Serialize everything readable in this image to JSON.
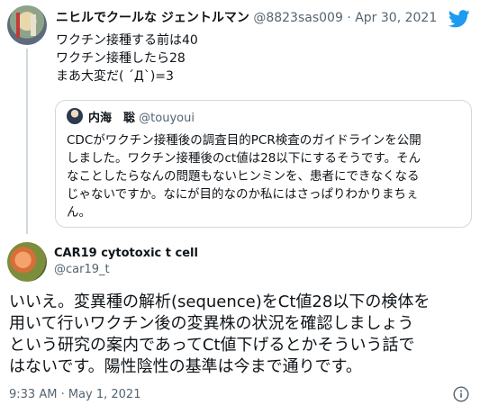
{
  "parent_tweet": {
    "display_name": "ニヒルでクールな ジェントルマン",
    "handle": "@8823sas009",
    "date": "Apr 30, 2021",
    "lines": [
      "ワクチン接種する前は40",
      "ワクチン接種したら28",
      "まあ大変だ( ´Д`)=3"
    ]
  },
  "quoted_tweet": {
    "display_name": "内海　聡",
    "handle": "@touyoui",
    "lines": [
      "CDCがワクチン接種後の調査目的PCR検査のガイドラインを公開",
      "しました。ワクチン接種後のct値は28以下にするそうです。そん",
      "なことしたらなんの問題もないヒンミンを、患者にできなくなる",
      "じゃないですか。なにが目的なのか私にはさっぱりわかりまちぇ",
      "ん。"
    ]
  },
  "reply_tweet": {
    "display_name": "CAR19 cytotoxic t cell",
    "handle": "@car19_t",
    "lines": [
      "いいえ。変異種の解析(sequence)をCt値28以下の検体を",
      "用いて行いワクチン後の変異株の状況を確認しましょう",
      "という研究の案内であってCt値下げるとかそういう話で",
      "はないです。陽性陰性の基準は今まで通りです。"
    ],
    "timestamp": "9:33 AM · May 1, 2021"
  },
  "icons": {
    "brand": "twitter-bird-icon",
    "info": "info-icon"
  },
  "colors": {
    "brand_blue": "#1d9bf0",
    "text": "#0f1419",
    "secondary_text": "#536471",
    "border": "#cfd9de"
  }
}
